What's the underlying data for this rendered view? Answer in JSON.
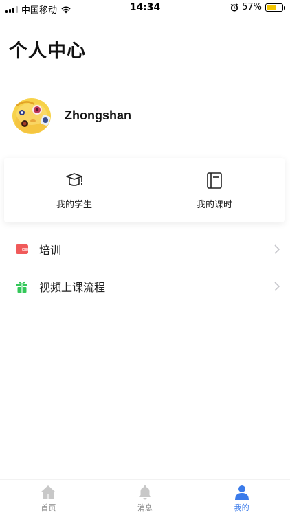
{
  "status_bar": {
    "carrier": "中国移动",
    "time": "14:34",
    "battery": "57%",
    "battery_level": 0.57,
    "icons": [
      "signal-icon",
      "wifi-icon",
      "alarm-icon",
      "battery-icon"
    ]
  },
  "page": {
    "title": "个人中心"
  },
  "profile": {
    "username": "Zhongshan",
    "avatar_icon": "emoji-avatar"
  },
  "quick_actions": [
    {
      "label": "我的学生",
      "icon": "graduation-cap-icon"
    },
    {
      "label": "我的课时",
      "icon": "notebook-icon"
    }
  ],
  "menu": [
    {
      "label": "培训",
      "icon": "wallet-icon",
      "color": "#f05a5a"
    },
    {
      "label": "视频上课流程",
      "icon": "gift-icon",
      "color": "#34c759"
    }
  ],
  "tab_bar": {
    "tabs": [
      {
        "label": "首页",
        "icon": "home-icon",
        "active": false
      },
      {
        "label": "消息",
        "icon": "bell-icon",
        "active": false
      },
      {
        "label": "我的",
        "icon": "person-icon",
        "active": true
      }
    ],
    "active_color": "#3b7bea",
    "inactive_color": "#c8c8c8"
  }
}
